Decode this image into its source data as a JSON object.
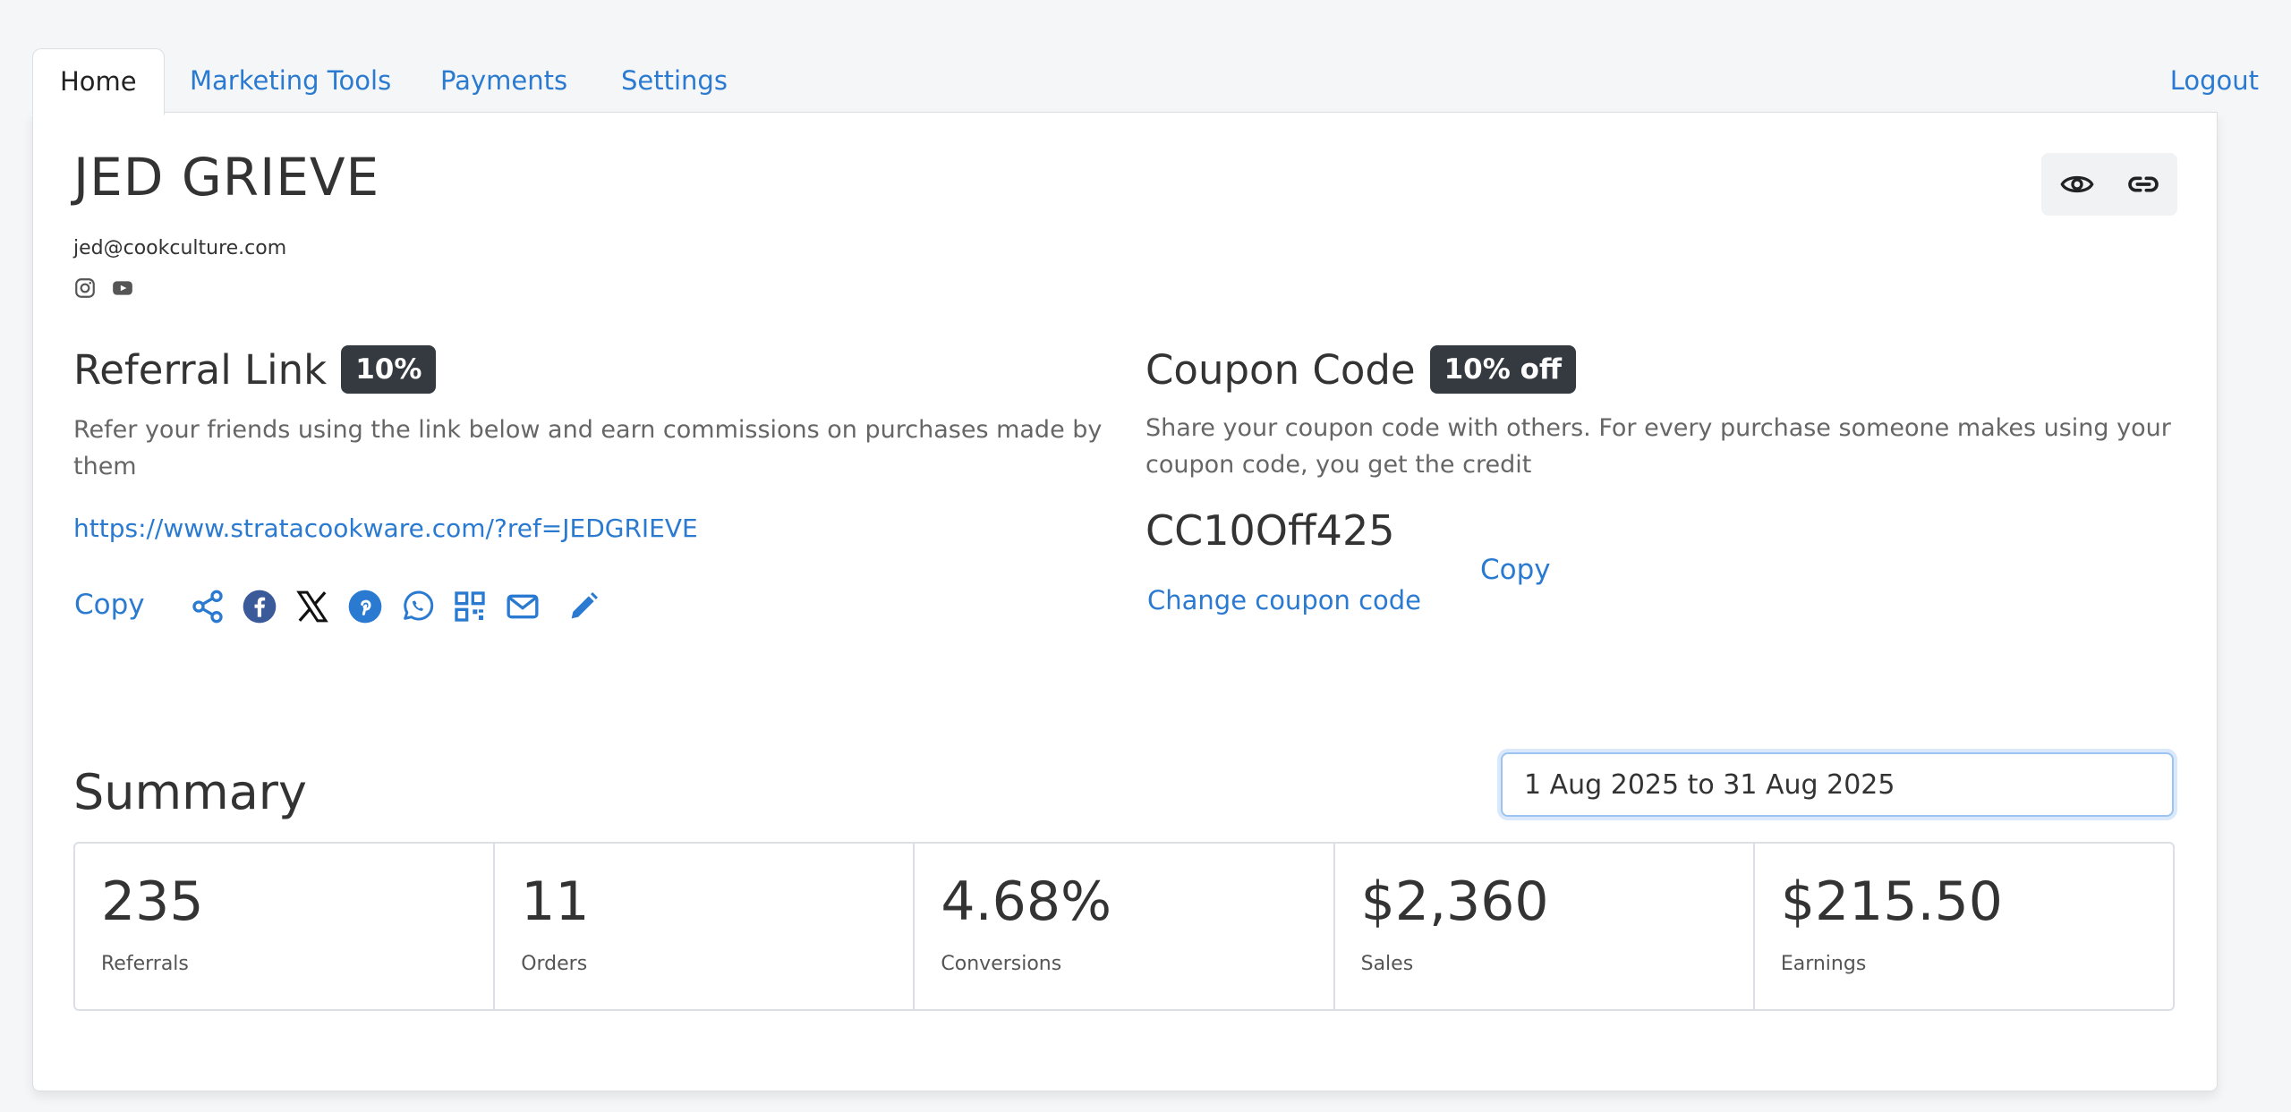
{
  "tabs": {
    "home": "Home",
    "marketing_tools": "Marketing Tools",
    "payments": "Payments",
    "settings": "Settings",
    "logout": "Logout"
  },
  "profile": {
    "name": "JED GRIEVE",
    "email": "jed@cookculture.com",
    "socials": [
      "instagram-icon",
      "youtube-icon"
    ]
  },
  "header_actions": [
    "eye-icon",
    "link-icon"
  ],
  "referral": {
    "title": "Referral Link",
    "badge": "10%",
    "description": "Refer your friends using the link below and earn commissions on purchases made by them",
    "url": "https://www.stratacookware.com/?ref=JEDGRIEVE",
    "copy_label": "Copy",
    "share_icons": [
      "share-icon",
      "facebook-icon",
      "x-icon",
      "pinterest-icon",
      "whatsapp-icon",
      "qr-code-icon",
      "email-icon",
      "edit-icon"
    ]
  },
  "coupon": {
    "title": "Coupon Code",
    "badge": "10% off",
    "description": "Share your coupon code with others. For every purchase someone makes using your coupon code, you get the credit",
    "code": "CC10Off425",
    "change_label": "Change coupon code",
    "copy_label": "Copy"
  },
  "summary": {
    "title": "Summary",
    "date_range": "1 Aug 2025 to 31 Aug 2025",
    "stats": [
      {
        "value": "235",
        "label": "Referrals"
      },
      {
        "value": "11",
        "label": "Orders"
      },
      {
        "value": "4.68%",
        "label": "Conversions"
      },
      {
        "value": "$2,360",
        "label": "Sales"
      },
      {
        "value": "$215.50",
        "label": "Earnings"
      }
    ]
  },
  "colors": {
    "accent": "#2a7ad1",
    "badge_bg": "#343a40",
    "page_bg": "#f5f6f8"
  }
}
